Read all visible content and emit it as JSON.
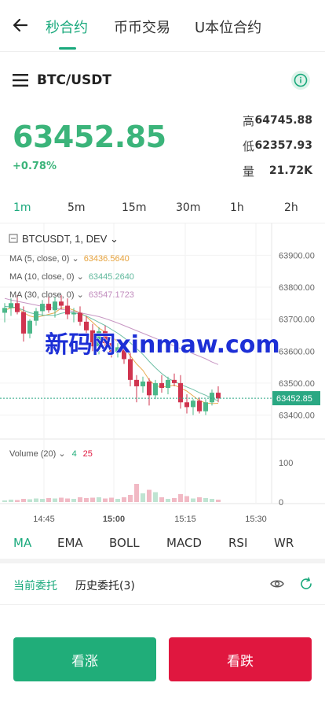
{
  "nav": {
    "tabs": [
      "秒合约",
      "币币交易",
      "U本位合约"
    ],
    "active_tab": 0
  },
  "pair": {
    "symbol": "BTC/USDT"
  },
  "price": {
    "last": "63452.85",
    "change": "+0.78%"
  },
  "stats": {
    "high_label": "高",
    "high": "64745.88",
    "low_label": "低",
    "low": "62357.93",
    "vol_label": "量",
    "vol": "21.72K"
  },
  "intervals": [
    "1m",
    "5m",
    "15m",
    "30m",
    "1h",
    "2h"
  ],
  "active_interval": 0,
  "chart_data": {
    "type": "candlestick",
    "header": "BTCUSDT, 1, DEV",
    "ma_lines": [
      {
        "label": "MA (5, close, 0)",
        "value": "63436.5640",
        "color": "#e6a23c"
      },
      {
        "label": "MA (10, close, 0)",
        "value": "63445.2640",
        "color": "#5fb89c"
      },
      {
        "label": "MA (30, close, 0)",
        "value": "63547.1723",
        "color": "#c18bbd"
      }
    ],
    "y_ticks": [
      "63900.00",
      "63800.00",
      "63700.00",
      "63600.00",
      "63500.00",
      "63400.00"
    ],
    "ylim": [
      63330,
      63950
    ],
    "current_price_label": "63452.85",
    "current_price": 63452.85,
    "volume_label": "Volume (20)",
    "volume_up_count": "4",
    "volume_down_count": "25",
    "volume_ticks": [
      "100",
      "0"
    ],
    "volume_max": 120,
    "x_ticks": [
      "14:45",
      "15:00",
      "15:15",
      "15:30"
    ],
    "candles": [
      {
        "o": 63720,
        "h": 63750,
        "l": 63690,
        "c": 63735,
        "v": 4
      },
      {
        "o": 63735,
        "h": 63765,
        "l": 63710,
        "c": 63750,
        "v": 6
      },
      {
        "o": 63750,
        "h": 63775,
        "l": 63715,
        "c": 63722,
        "v": 5
      },
      {
        "o": 63722,
        "h": 63740,
        "l": 63630,
        "c": 63655,
        "v": 8
      },
      {
        "o": 63655,
        "h": 63700,
        "l": 63640,
        "c": 63695,
        "v": 7
      },
      {
        "o": 63695,
        "h": 63735,
        "l": 63680,
        "c": 63725,
        "v": 9
      },
      {
        "o": 63725,
        "h": 63760,
        "l": 63710,
        "c": 63748,
        "v": 8
      },
      {
        "o": 63748,
        "h": 63770,
        "l": 63720,
        "c": 63728,
        "v": 10
      },
      {
        "o": 63728,
        "h": 63770,
        "l": 63705,
        "c": 63755,
        "v": 9
      },
      {
        "o": 63755,
        "h": 63775,
        "l": 63730,
        "c": 63742,
        "v": 11
      },
      {
        "o": 63742,
        "h": 63765,
        "l": 63700,
        "c": 63715,
        "v": 9
      },
      {
        "o": 63715,
        "h": 63735,
        "l": 63690,
        "c": 63720,
        "v": 8
      },
      {
        "o": 63720,
        "h": 63740,
        "l": 63680,
        "c": 63692,
        "v": 12
      },
      {
        "o": 63692,
        "h": 63710,
        "l": 63640,
        "c": 63665,
        "v": 10
      },
      {
        "o": 63665,
        "h": 63685,
        "l": 63600,
        "c": 63615,
        "v": 11
      },
      {
        "o": 63615,
        "h": 63675,
        "l": 63590,
        "c": 63662,
        "v": 12
      },
      {
        "o": 63662,
        "h": 63680,
        "l": 63610,
        "c": 63625,
        "v": 9
      },
      {
        "o": 63625,
        "h": 63640,
        "l": 63580,
        "c": 63598,
        "v": 11
      },
      {
        "o": 63598,
        "h": 63625,
        "l": 63580,
        "c": 63612,
        "v": 8
      },
      {
        "o": 63612,
        "h": 63630,
        "l": 63560,
        "c": 63575,
        "v": 12
      },
      {
        "o": 63575,
        "h": 63595,
        "l": 63490,
        "c": 63510,
        "v": 18
      },
      {
        "o": 63510,
        "h": 63525,
        "l": 63440,
        "c": 63490,
        "v": 46
      },
      {
        "o": 63490,
        "h": 63520,
        "l": 63470,
        "c": 63505,
        "v": 22
      },
      {
        "o": 63505,
        "h": 63515,
        "l": 63430,
        "c": 63462,
        "v": 31
      },
      {
        "o": 63462,
        "h": 63510,
        "l": 63450,
        "c": 63500,
        "v": 25
      },
      {
        "o": 63500,
        "h": 63525,
        "l": 63470,
        "c": 63485,
        "v": 12
      },
      {
        "o": 63485,
        "h": 63520,
        "l": 63465,
        "c": 63510,
        "v": 8
      },
      {
        "o": 63510,
        "h": 63530,
        "l": 63490,
        "c": 63500,
        "v": 10
      },
      {
        "o": 63500,
        "h": 63525,
        "l": 63420,
        "c": 63440,
        "v": 20
      },
      {
        "o": 63440,
        "h": 63465,
        "l": 63405,
        "c": 63425,
        "v": 15
      },
      {
        "o": 63425,
        "h": 63450,
        "l": 63400,
        "c": 63445,
        "v": 9
      },
      {
        "o": 63445,
        "h": 63455,
        "l": 63405,
        "c": 63412,
        "v": 12
      },
      {
        "o": 63412,
        "h": 63450,
        "l": 63400,
        "c": 63440,
        "v": 10
      },
      {
        "o": 63440,
        "h": 63480,
        "l": 63430,
        "c": 63470,
        "v": 8
      },
      {
        "o": 63470,
        "h": 63490,
        "l": 63440,
        "c": 63452,
        "v": 6
      }
    ],
    "ma5": [
      63728,
      63735,
      63737,
      63720,
      63710,
      63705,
      63710,
      63715,
      63720,
      63735,
      63735,
      63728,
      63720,
      63708,
      63690,
      63672,
      63660,
      63645,
      63630,
      63612,
      63585,
      63560,
      63540,
      63510,
      63492,
      63488,
      63490,
      63494,
      63485,
      63475,
      63460,
      63445,
      63438,
      63436,
      63437
    ],
    "ma10": [
      63740,
      63738,
      63736,
      63728,
      63720,
      63716,
      63713,
      63712,
      63712,
      63718,
      63722,
      63720,
      63716,
      63710,
      63700,
      63690,
      63680,
      63668,
      63656,
      63642,
      63626,
      63608,
      63590,
      63568,
      63548,
      63530,
      63515,
      63505,
      63496,
      63488,
      63480,
      63470,
      63462,
      63452,
      63445
    ],
    "ma30": [
      63765,
      63760,
      63756,
      63752,
      63748,
      63744,
      63740,
      63737,
      63734,
      63731,
      63728,
      63724,
      63720,
      63716,
      63712,
      63708,
      63702,
      63695,
      63688,
      63680,
      63672,
      63664,
      63656,
      63648,
      63640,
      63632,
      63624,
      63616,
      63608,
      63600,
      63592,
      63584,
      63576,
      63566,
      63558
    ]
  },
  "watermark": "新码网xinmaw.com",
  "indicators": [
    "MA",
    "EMA",
    "BOLL",
    "MACD",
    "RSI",
    "WR"
  ],
  "active_indicator": 0,
  "orders": {
    "current_tab": "当前委托",
    "history_tab": "历史委托(3)"
  },
  "buttons": {
    "up": "看涨",
    "down": "看跌"
  },
  "colors": {
    "accent": "#1aa97c",
    "up": "#20ad79",
    "down": "#e0173f",
    "candle_up": "#4cb88a",
    "candle_down": "#d0344f"
  }
}
